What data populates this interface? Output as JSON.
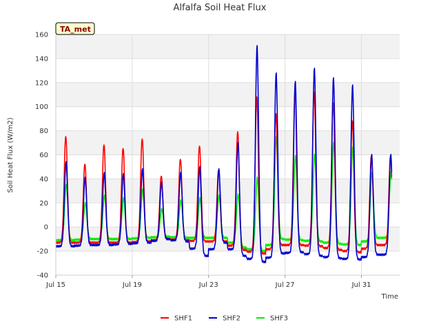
{
  "chart_data": {
    "type": "line",
    "title": "Alfalfa Soil Heat Flux",
    "xlabel": "Time",
    "ylabel": "Soil Heat Flux (W/m2)",
    "badge": "TA_met",
    "xlim": [
      "2024-07-15",
      "2024-08-02"
    ],
    "ylim": [
      -40,
      160
    ],
    "yticks": [
      -40,
      -20,
      0,
      20,
      40,
      60,
      80,
      100,
      120,
      140,
      160
    ],
    "xticks": [
      {
        "date": "2024-07-15",
        "label": "Jul 15"
      },
      {
        "date": "2024-07-19",
        "label": "Jul 19"
      },
      {
        "date": "2024-07-23",
        "label": "Jul 23"
      },
      {
        "date": "2024-07-27",
        "label": "Jul 27"
      },
      {
        "date": "2024-07-31",
        "label": "Jul 31"
      }
    ],
    "grid": true,
    "legend_position": "bottom",
    "x": [
      "2024-07-15",
      "2024-07-16",
      "2024-07-17",
      "2024-07-18",
      "2024-07-19",
      "2024-07-20",
      "2024-07-21",
      "2024-07-22",
      "2024-07-23",
      "2024-07-24",
      "2024-07-25",
      "2024-07-26",
      "2024-07-27",
      "2024-07-28",
      "2024-07-29",
      "2024-07-30",
      "2024-07-31",
      "2024-08-01"
    ],
    "series": [
      {
        "name": "SHF1",
        "color": "#ff0000",
        "daily_max": [
          76,
          53,
          69,
          66,
          74,
          43,
          57,
          68,
          48,
          80,
          109,
          95,
          113,
          113,
          104,
          89,
          60,
          60
        ],
        "daily_min": [
          -13,
          -13,
          -13,
          -13,
          -12,
          -10,
          -11,
          -12,
          -12,
          -19,
          -22,
          -15,
          -15,
          -16,
          -19,
          -21,
          -15,
          -15
        ]
      },
      {
        "name": "SHF2",
        "color": "#0000cc",
        "daily_max": [
          54,
          41,
          45,
          44,
          48,
          37,
          45,
          50,
          48,
          70,
          151,
          128,
          121,
          132,
          124,
          118,
          60,
          60
        ],
        "daily_min": [
          -16,
          -15,
          -15,
          -14,
          -13,
          -10,
          -12,
          -24,
          -13,
          -24,
          -29,
          -22,
          -21,
          -24,
          -26,
          -27,
          -23,
          -23
        ]
      },
      {
        "name": "SHF3",
        "color": "#00ee00",
        "daily_max": [
          35,
          20,
          26,
          24,
          31,
          15,
          22,
          24,
          26,
          27,
          41,
          75,
          59,
          60,
          70,
          66,
          45,
          45
        ],
        "daily_min": [
          -11,
          -10,
          -10,
          -10,
          -9,
          -8,
          -9,
          -9,
          -9,
          -17,
          -20,
          -10,
          -11,
          -12,
          -14,
          -15,
          -9,
          -9
        ]
      }
    ]
  }
}
